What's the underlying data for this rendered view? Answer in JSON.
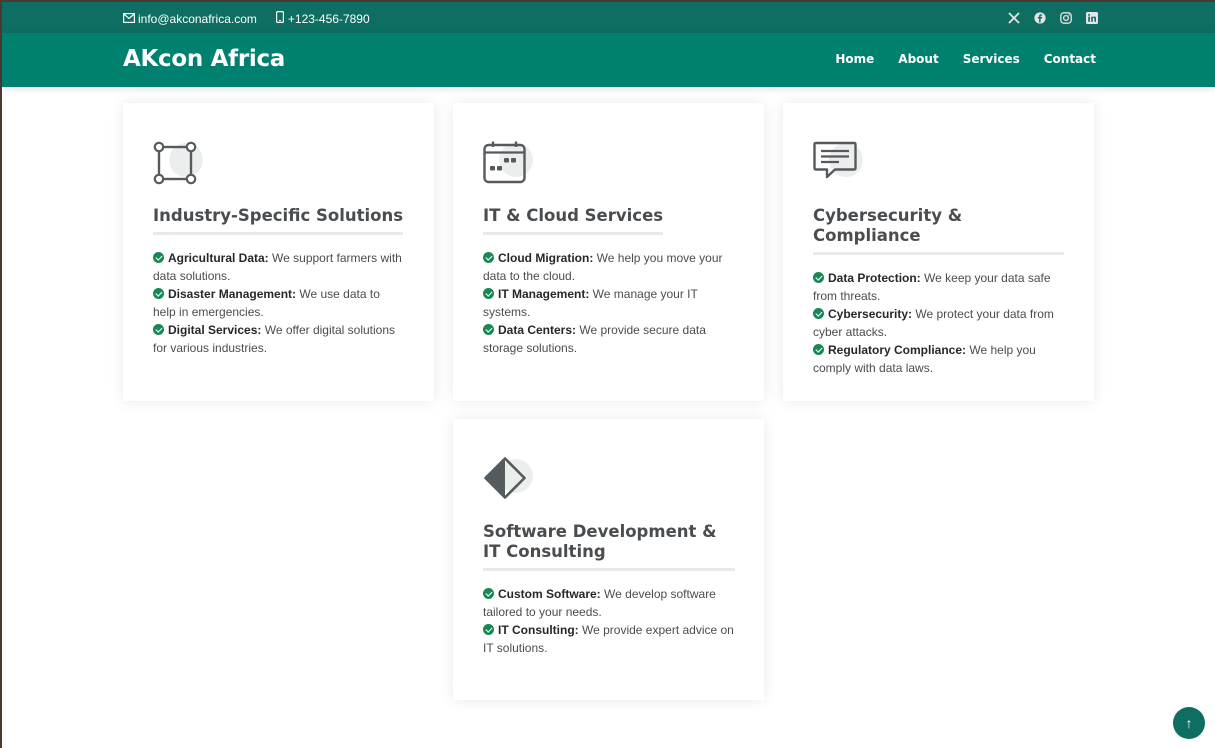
{
  "topbar": {
    "email": "info@akconafrica.com",
    "phone": "+123-456-7890",
    "social": [
      "x-icon",
      "facebook-icon",
      "instagram-icon",
      "linkedin-icon"
    ]
  },
  "header": {
    "brand": "AKcon Africa",
    "nav": [
      "Home",
      "About",
      "Services",
      "Contact"
    ]
  },
  "colors": {
    "topbar": "#0e6e61",
    "header": "#00816f",
    "check": "#198754",
    "heading": "#4a4d50"
  },
  "cards": [
    {
      "icon": "bounding-box-icon",
      "title": "Industry-Specific Solutions",
      "items": [
        {
          "label": "Agricultural Data:",
          "text": " We support farmers with data solutions."
        },
        {
          "label": "Disaster Management:",
          "text": " We use data to help in emergencies."
        },
        {
          "label": "Digital Services:",
          "text": " We offer digital solutions for various industries."
        }
      ]
    },
    {
      "icon": "calendar-icon",
      "title": "IT & Cloud Services",
      "items": [
        {
          "label": "Cloud Migration:",
          "text": " We help you move your data to the cloud."
        },
        {
          "label": "IT Management:",
          "text": " We manage your IT systems."
        },
        {
          "label": "Data Centers:",
          "text": " We provide secure data storage solutions."
        }
      ]
    },
    {
      "icon": "chat-text-icon",
      "title": "Cybersecurity & Compliance",
      "items": [
        {
          "label": "Data Protection:",
          "text": " We keep your data safe from threats."
        },
        {
          "label": "Cybersecurity:",
          "text": " We protect your data from cyber attacks."
        },
        {
          "label": "Regulatory Compliance:",
          "text": " We help you comply with data laws."
        }
      ]
    },
    {
      "icon": "diamond-half-icon",
      "title": "Software Development & IT Consulting",
      "items": [
        {
          "label": "Custom Software:",
          "text": " We develop software tailored to your needs."
        },
        {
          "label": "IT Consulting:",
          "text": " We provide expert advice on IT solutions."
        }
      ]
    }
  ],
  "scroll_top": {
    "icon": "arrow-up-icon",
    "glyph": "↑"
  }
}
